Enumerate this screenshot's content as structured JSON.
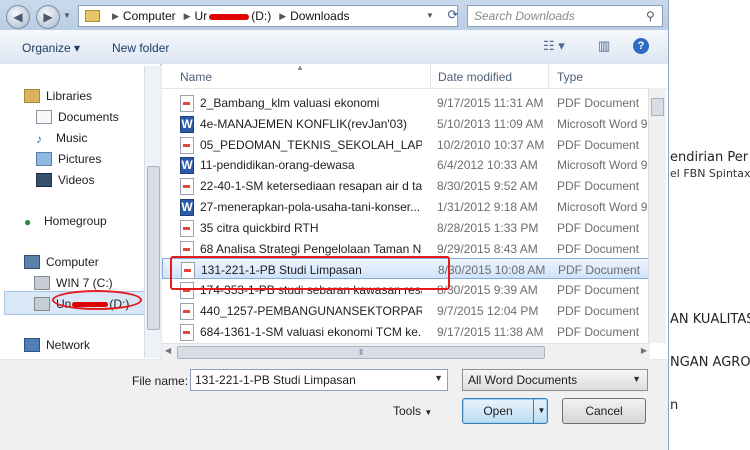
{
  "window": {
    "breadcrumbs": [
      "Computer",
      "Ur",
      "(D:)",
      "Downloads"
    ],
    "search_placeholder": "Search Downloads"
  },
  "toolbar": {
    "organize": "Organize",
    "new_folder": "New folder"
  },
  "nav": {
    "libraries": "Libraries",
    "documents": "Documents",
    "music": "Music",
    "pictures": "Pictures",
    "videos": "Videos",
    "homegroup": "Homegroup",
    "computer": "Computer",
    "win7": "WIN 7 (C:)",
    "drive_d_visible": "Un",
    "drive_d_suffix": "(D:)",
    "network": "Network"
  },
  "columns": {
    "name": "Name",
    "date": "Date modified",
    "type": "Type"
  },
  "files": [
    {
      "name": "2_Bambang_klm valuasi ekonomi",
      "date": "9/17/2015 11:31 AM",
      "type": "PDF Document",
      "icon": "pdf-icon"
    },
    {
      "name": "4e-MANAJEMEN KONFLIK(revJan'03)",
      "date": "5/10/2013 11:09 AM",
      "type": "Microsoft Word 9",
      "icon": "word-icon"
    },
    {
      "name": "05_PEDOMAN_TEKNIS_SEKOLAH_LAPAN...",
      "date": "10/2/2010 10:37 AM",
      "type": "PDF Document",
      "icon": "pdf-icon"
    },
    {
      "name": "11-pendidikan-orang-dewasa",
      "date": "6/4/2012 10:33 AM",
      "type": "Microsoft Word 9",
      "icon": "word-icon"
    },
    {
      "name": "22-40-1-SM ketersediaan resapan air d ta...",
      "date": "8/30/2015 9:52 AM",
      "type": "PDF Document",
      "icon": "pdf-icon"
    },
    {
      "name": "27-menerapkan-pola-usaha-tani-konser...",
      "date": "1/31/2012 9:18 AM",
      "type": "Microsoft Word 9",
      "icon": "word-icon"
    },
    {
      "name": "35 citra quickbird RTH",
      "date": "8/28/2015 1:33 PM",
      "type": "PDF Document",
      "icon": "pdf-icon"
    },
    {
      "name": "68 Analisa Strategi Pengelolaan Taman N...",
      "date": "9/29/2015 8:43 AM",
      "type": "PDF Document",
      "icon": "pdf-icon"
    },
    {
      "name": "131-221-1-PB Studi Limpasan",
      "date": "8/30/2015 10:08 AM",
      "type": "PDF Document",
      "icon": "pdf-icon"
    },
    {
      "name": "174-353-1-PB studi sebaran kawasan resa...",
      "date": "8/30/2015 9:39 AM",
      "type": "PDF Document",
      "icon": "pdf-icon"
    },
    {
      "name": "440_1257-PEMBANGUNANSEKTORPARI...",
      "date": "9/7/2015 12:04 PM",
      "type": "PDF Document",
      "icon": "pdf-icon"
    },
    {
      "name": "684-1361-1-SM valuasi ekonomi TCM ke...",
      "date": "9/17/2015 11:38 AM",
      "type": "PDF Document",
      "icon": "pdf-icon"
    }
  ],
  "selected_index": 8,
  "bottom": {
    "file_name_label": "File name:",
    "file_name_value": "131-221-1-PB Studi Limpasan",
    "filter_value": "All Word Documents",
    "tools": "Tools",
    "open": "Open",
    "cancel": "Cancel"
  },
  "background_doc": {
    "line1": "endirian Per",
    "line2": "el FBN Spintax",
    "line3": "AN KUALITAS",
    "line4": "NGAN AGRO",
    "line5": "n"
  },
  "colors": {
    "annotation": "#e31b1b",
    "selection": "#cfe3fb",
    "accent": "#1e3c64"
  }
}
